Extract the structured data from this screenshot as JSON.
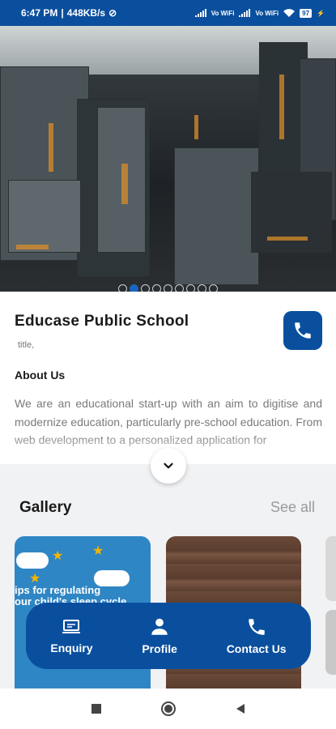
{
  "status_bar": {
    "time": "6:47 PM",
    "speed": "448KB/s",
    "network_1": "Vo WiFi",
    "network_2": "Vo WiFi",
    "battery": "97"
  },
  "hero": {
    "slide_count": 9,
    "active_index": 1
  },
  "school": {
    "name": "Educase Public School",
    "subtitle": "title,"
  },
  "about": {
    "heading": "About Us",
    "text": "We are an educational start-up with an aim to digitise and modernize education, particularly pre-school education. From web development to a personalized application for"
  },
  "gallery": {
    "heading": "Gallery",
    "see_all": "See all",
    "card1_caption": "ips for regulating\nour child's sleep cycle"
  },
  "bottom_nav": {
    "items": [
      {
        "label": "Enquiry",
        "icon": "laptop-icon"
      },
      {
        "label": "Profile",
        "icon": "person-icon"
      },
      {
        "label": "Contact Us",
        "icon": "phone-icon"
      }
    ]
  },
  "colors": {
    "brand": "#0a4f9e",
    "gallery_bg": "#f1f2f4"
  }
}
